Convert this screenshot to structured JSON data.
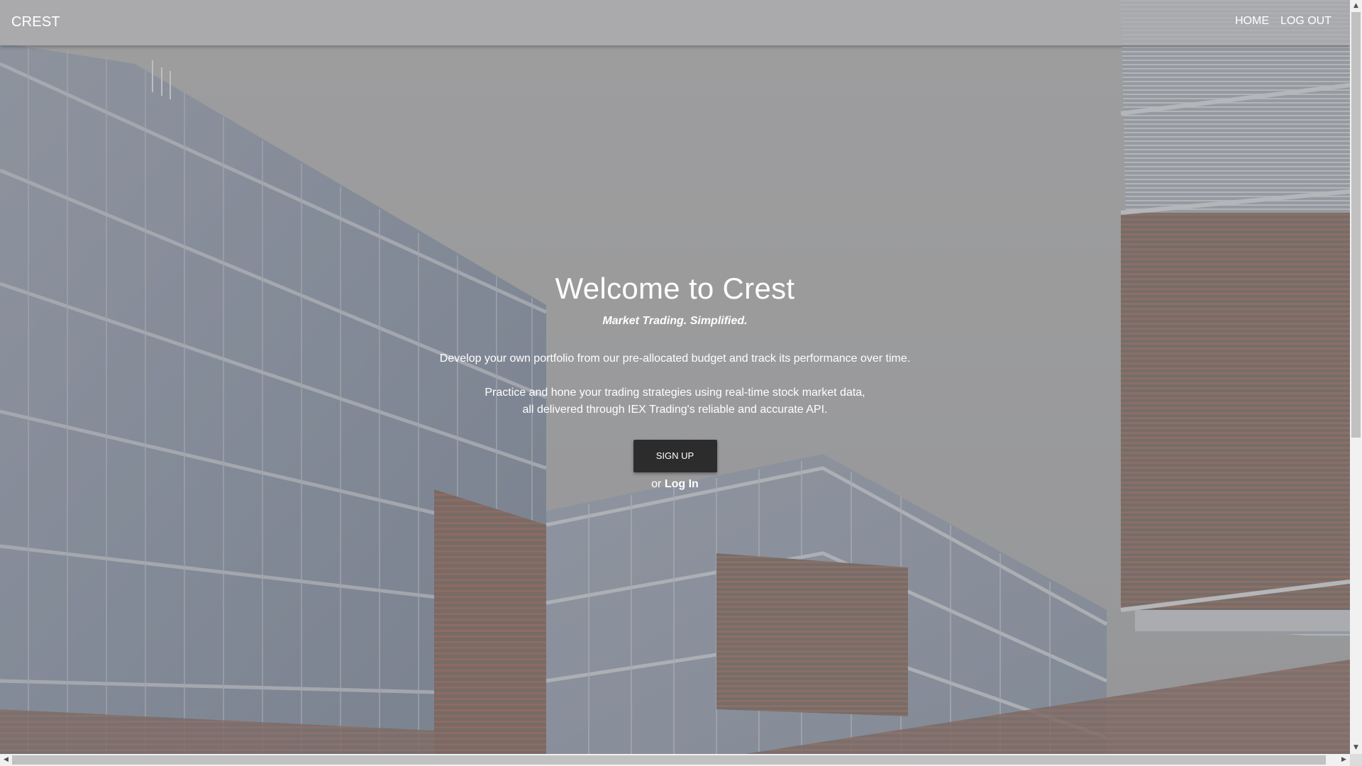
{
  "navbar": {
    "brand": "CREST",
    "links": [
      {
        "label": "HOME"
      },
      {
        "label": "LOG OUT"
      }
    ]
  },
  "hero": {
    "title": "Welcome to Crest",
    "tagline": "Market Trading. Simplified.",
    "description": "Develop your own portfolio from our pre-allocated budget and track its performance over time.",
    "practice_line1": "Practice and hone your trading strategies using real-time stock market data,",
    "practice_line2": "all delivered through IEX Trading's reliable and accurate API.",
    "signup_label": "SIGN UP",
    "or_text": "or",
    "login_label": "Log In"
  },
  "scrollbars": {
    "up_icon": "arrow-up-icon",
    "down_icon": "arrow-down-icon",
    "left_icon": "arrow-left-icon",
    "right_icon": "arrow-right-icon"
  },
  "colors": {
    "navbar_bg": "#b0b0b2",
    "button_bg": "#2c2c2c",
    "text": "#ffffff"
  }
}
